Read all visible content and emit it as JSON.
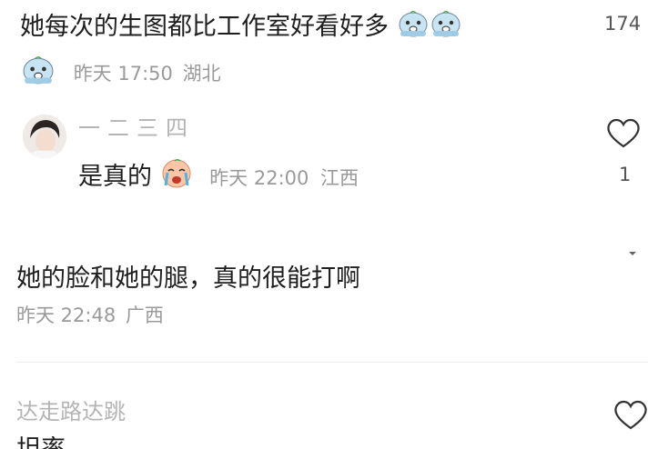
{
  "comment1": {
    "text": "她每次的生图都比工作室好看好多",
    "like_count": "174",
    "time": "昨天 17:50",
    "location": "湖北",
    "emoji_icon": "crying-face-emoji"
  },
  "reply1": {
    "username": "一二三四",
    "text": "是真的",
    "time": "昨天 22:00",
    "location": "江西",
    "like_count": "1",
    "emoji_icon": "loudly-crying-emoji"
  },
  "comment2": {
    "text": "她的脸和她的腿，真的很能打啊",
    "time": "昨天 22:48",
    "location": "广西"
  },
  "comment3": {
    "username": "达走路达跳",
    "text_partial": "坦率"
  },
  "colors": {
    "meta_gray": "#9a9a9a",
    "text_dark": "#1f1f1f",
    "emoji_blue": "#c8e3f2"
  }
}
